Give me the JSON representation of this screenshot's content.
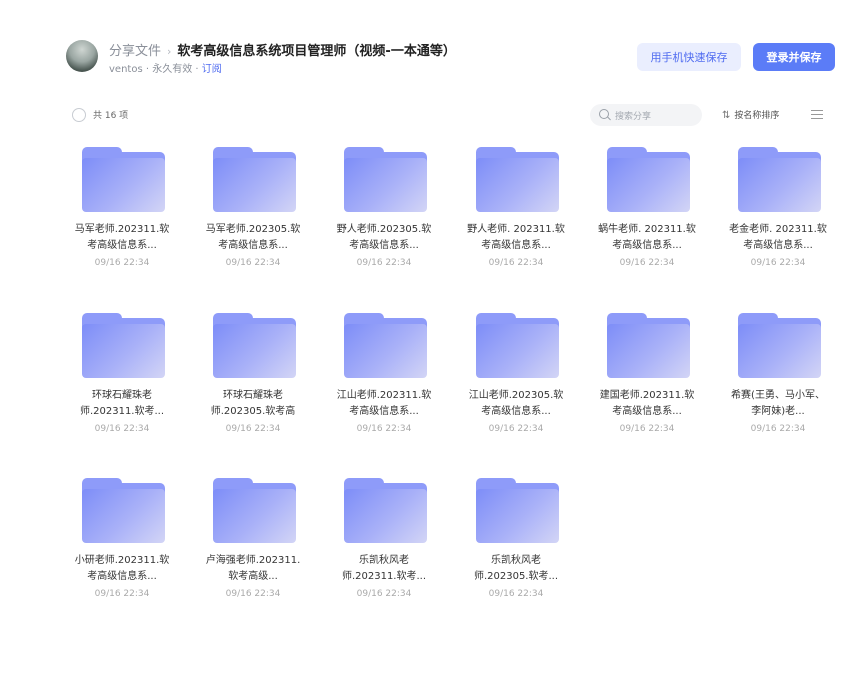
{
  "header": {
    "breadcrumb_root": "分享文件",
    "breadcrumb_sep": "›",
    "title": "软考高级信息系统项目管理师（视频-一本通等）",
    "user": "ventos",
    "validity": " · 永久有效 · ",
    "subscribe": "订阅",
    "phone_save_label": "用手机快速保存",
    "login_save_label": "登录并保存"
  },
  "toolbar": {
    "count_label": "共 16 项",
    "search_placeholder": "搜索分享",
    "sort_label": "按名称排序",
    "sort_icon": "sort-arrows-icon",
    "menu_icon": "list-menu-icon"
  },
  "colors": {
    "accent": "#5b7cf7",
    "accent_light": "#eaeefe",
    "folder": "#8e9bf9"
  },
  "files": [
    {
      "name": "马军老师.202311.软考高级信息系...",
      "date": "09/16 22:34"
    },
    {
      "name": "马军老师.202305.软考高级信息系...",
      "date": "09/16 22:34"
    },
    {
      "name": "野人老师.202305.软考高级信息系...",
      "date": "09/16 22:34"
    },
    {
      "name": "野人老师. 202311.软考高级信息系...",
      "date": "09/16 22:34"
    },
    {
      "name": "蜗牛老师. 202311.软考高级信息系...",
      "date": "09/16 22:34"
    },
    {
      "name": "老金老师. 202311.软考高级信息系...",
      "date": "09/16 22:34"
    },
    {
      "name": "环球石耀珠老师.202311.软考...",
      "date": "09/16 22:34"
    },
    {
      "name": "环球石耀珠老师.202305.软考高级...",
      "date": "09/16 22:34"
    },
    {
      "name": "江山老师.202311.软考高级信息系...",
      "date": "09/16 22:34"
    },
    {
      "name": "江山老师.202305.软考高级信息系...",
      "date": "09/16 22:34"
    },
    {
      "name": "建国老师.202311.软考高级信息系...",
      "date": "09/16 22:34"
    },
    {
      "name": "希赛(王勇、马小军、李阿妹)老...",
      "date": "09/16 22:34"
    },
    {
      "name": "小研老师.202311.软考高级信息系...",
      "date": "09/16 22:34"
    },
    {
      "name": "卢海强老师.202311.软考高级...",
      "date": "09/16 22:34"
    },
    {
      "name": "乐凯秋风老师.202311.软考...",
      "date": "09/16 22:34"
    },
    {
      "name": "乐凯秋风老师.202305.软考...",
      "date": "09/16 22:34"
    }
  ]
}
